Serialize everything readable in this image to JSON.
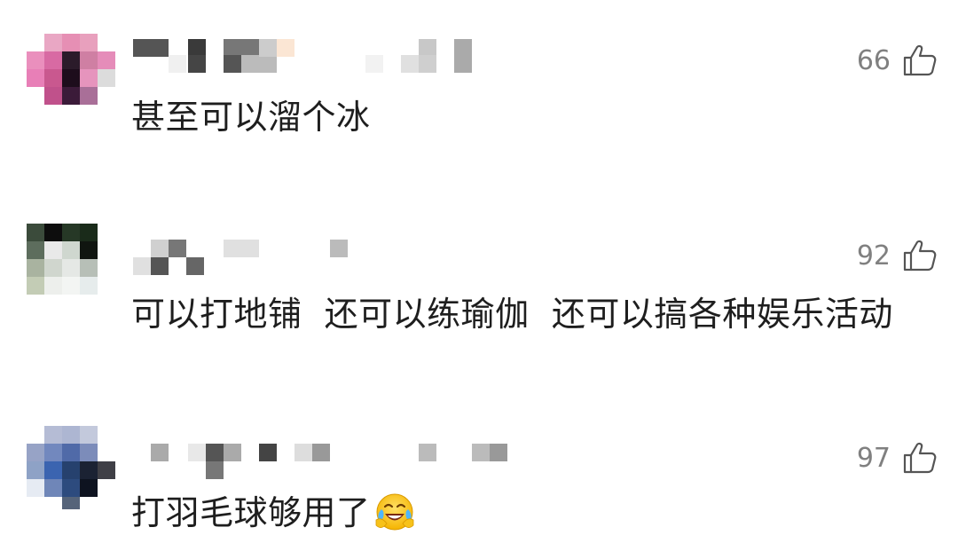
{
  "comments": [
    {
      "text": "甚至可以溜个冰",
      "likes": "66",
      "avatar_icon": "blurred-avatar-pink",
      "username_icon": "blurred-username"
    },
    {
      "text": "可以打地铺  还可以练瑜伽  还可以搞各种娱乐活动",
      "likes": "92",
      "avatar_icon": "blurred-avatar-green",
      "username_icon": "blurred-username"
    },
    {
      "text": "打羽毛球够用了",
      "likes": "97",
      "avatar_icon": "blurred-avatar-blue",
      "username_icon": "blurred-username",
      "emoji": "laughing-crying-emoji"
    }
  ],
  "colors": {
    "text": "#1e1e1e",
    "like_gray": "#808080"
  }
}
